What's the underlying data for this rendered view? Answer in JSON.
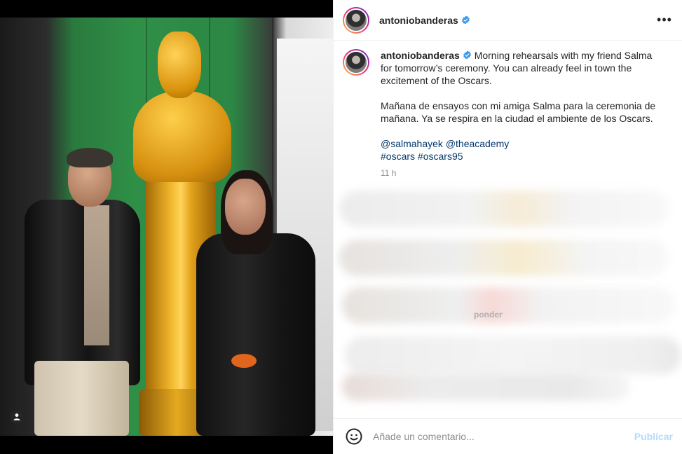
{
  "header": {
    "username": "antoniobanderas",
    "verified_icon": "verified-badge-icon",
    "more_icon": "more-options-icon",
    "more_label": "•••"
  },
  "caption": {
    "username": "antoniobanderas",
    "text_en": "Morning rehearsals with my friend Salma for tomorrow’s ceremony. You can already feel in town the excitement of the Oscars.",
    "text_es": "Mañana de ensayos con mi amiga Salma para la ceremonia de mañana. Ya se respira en la ciudad el ambiente de los Oscars.",
    "mention_1": "@salmahayek",
    "mention_2": "@theacademy",
    "hashtag_1": "#oscars",
    "hashtag_2": "#oscars95",
    "time": "11 h"
  },
  "comments_section": {
    "blurred": true,
    "partial_visible_text": "ponder"
  },
  "footer": {
    "emoji_icon": "emoji-smiley-icon",
    "comment_placeholder": "Añade un comentario...",
    "publish_label": "Publicar"
  },
  "photo": {
    "tag_icon": "user-tag-icon",
    "description_icon": "photo"
  },
  "colors": {
    "link": "#00376b",
    "verified": "#3897f0",
    "publish_disabled": "#b3dbff",
    "meta": "#8e8e8e"
  }
}
